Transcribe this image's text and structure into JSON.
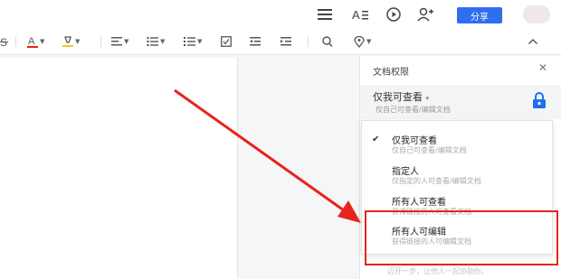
{
  "header": {
    "share_label": "分享",
    "icons": [
      "list-icon",
      "text-style-icon",
      "play-icon",
      "add-user-icon"
    ]
  },
  "toolbar": {
    "items": [
      "strikethrough-icon",
      "font-color-icon",
      "highlight-icon",
      "align-icon",
      "bullet-list-icon",
      "numbered-list-icon",
      "checkbox-icon",
      "outdent-icon",
      "indent-icon",
      "search-icon",
      "location-icon",
      "collapse-icon"
    ]
  },
  "panel": {
    "title": "文档权限",
    "current_permission": "仅我可查看",
    "current_permission_desc": "仅自己可查看/编辑文档",
    "footer_text": "迈开一步，让他人一起协助你。"
  },
  "dropdown": {
    "options": [
      {
        "label": "仅我可查看",
        "desc": "仅自己可查看/编辑文档",
        "checked": true
      },
      {
        "label": "指定人",
        "desc": "仅指定的人可查看/编辑文档",
        "checked": false
      },
      {
        "label": "所有人可查看",
        "desc": "获得链接的人可查看文档",
        "checked": false
      },
      {
        "label": "所有人可编辑",
        "desc": "获得链接的人可编辑文档",
        "checked": false
      }
    ]
  },
  "colors": {
    "accent": "#2f6ef0",
    "annotation_red": "#e8231d",
    "lock_blue": "#1e6ff0"
  }
}
